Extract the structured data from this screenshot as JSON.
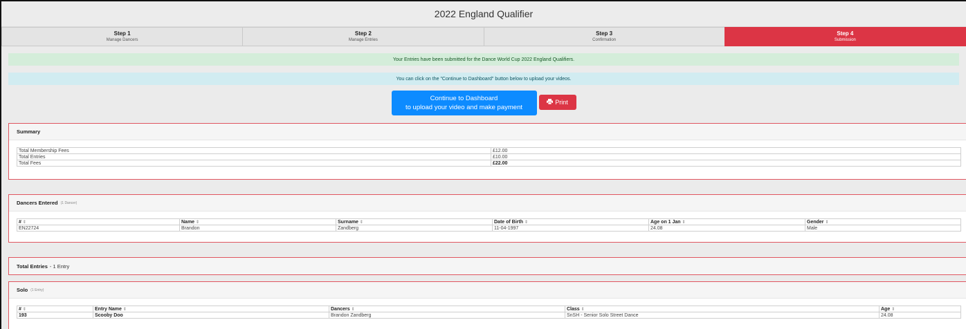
{
  "page": {
    "title": "2022 England Qualifier"
  },
  "steps": [
    {
      "title": "Step 1",
      "subtitle": "Manage Dancers"
    },
    {
      "title": "Step 2",
      "subtitle": "Manage Entries"
    },
    {
      "title": "Step 3",
      "subtitle": "Confirmation"
    },
    {
      "title": "Step 4",
      "subtitle": "Submission"
    }
  ],
  "alerts": {
    "success": "Your Entries have been submitted for the Dance World Cup 2022 England Qualifiers.",
    "info": "You can click on the \"Continue to Dashboard\" button below to upload your videos."
  },
  "buttons": {
    "continue_line1": "Continue to Dashboard",
    "continue_line2": "to upload your video and make payment",
    "print": "Print"
  },
  "summary": {
    "heading": "Summary",
    "rows": [
      {
        "label": "Total Membership Fees",
        "value": "£12.00"
      },
      {
        "label": "Total Entries",
        "value": "£10.00"
      },
      {
        "label": "Total Fees",
        "value": "£22.00"
      }
    ]
  },
  "dancers": {
    "heading": "Dancers Entered",
    "count": "(1 Dancer)",
    "columns": [
      "#",
      "Name",
      "Surname",
      "Date of Birth",
      "Age on 1 Jan",
      "Gender"
    ],
    "rows": [
      [
        "EN22724",
        "Brandon",
        "Zandberg",
        "11-04-1997",
        "24.08",
        "Male"
      ]
    ]
  },
  "total_entries": {
    "heading": "Total Entries",
    "suffix": "- 1 Entry"
  },
  "solo": {
    "heading": "Solo",
    "count": "(1 Entry)",
    "columns": [
      "#",
      "Entry Name",
      "Dancers",
      "Class",
      "Age"
    ],
    "rows": [
      [
        "193",
        "Scooby Doo",
        "Brandon Zandberg",
        "SnSH - Senior Solo Street Dance",
        "24.08"
      ]
    ]
  },
  "icons": {
    "print": "print-icon",
    "sort": "sort-icon"
  },
  "colors": {
    "active_step": "#dc3545",
    "primary_button": "#0d8bff",
    "success_bg": "#d4edda",
    "info_bg": "#d1ecf1",
    "panel_border": "#e0555f"
  }
}
